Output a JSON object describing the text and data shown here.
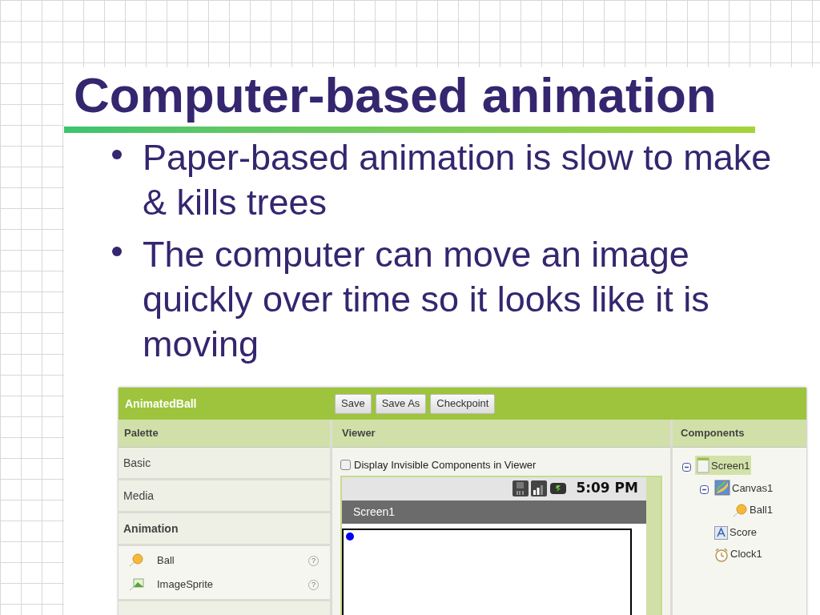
{
  "slide": {
    "title": "Computer-based animation",
    "bullets": [
      "Paper-based animation is slow to make & kills trees",
      "The computer can move an image quickly over time so it looks like it is moving"
    ]
  },
  "app": {
    "project_title": "AnimatedBall",
    "buttons": [
      "Save",
      "Save As",
      "Checkpoint"
    ],
    "palette": {
      "header": "Palette",
      "categories": [
        {
          "label": "Basic",
          "expanded": false
        },
        {
          "label": "Media",
          "expanded": false
        },
        {
          "label": "Animation",
          "expanded": true,
          "items": [
            {
              "label": "Ball",
              "kind": "ball",
              "help": "?"
            },
            {
              "label": "ImageSprite",
              "kind": "sprite",
              "help": "?"
            }
          ]
        }
      ]
    },
    "viewer": {
      "header": "Viewer",
      "checkbox": {
        "label": "Display Invisible Components in Viewer",
        "checked": false
      },
      "phone": {
        "time": "5:09 PM",
        "screen_title": "Screen1"
      }
    },
    "components": {
      "header": "Components",
      "tree": [
        {
          "label": "Screen1",
          "kind": "screen",
          "selected": true,
          "expanded": true,
          "children": [
            {
              "label": "Canvas1",
              "kind": "canvas",
              "selected": false,
              "expanded": true,
              "children": [
                {
                  "label": "Ball1",
                  "kind": "ball",
                  "selected": false
                }
              ]
            },
            {
              "label": "Score",
              "kind": "label",
              "selected": false
            },
            {
              "label": "Clock1",
              "kind": "clock",
              "selected": false
            }
          ]
        }
      ]
    }
  }
}
